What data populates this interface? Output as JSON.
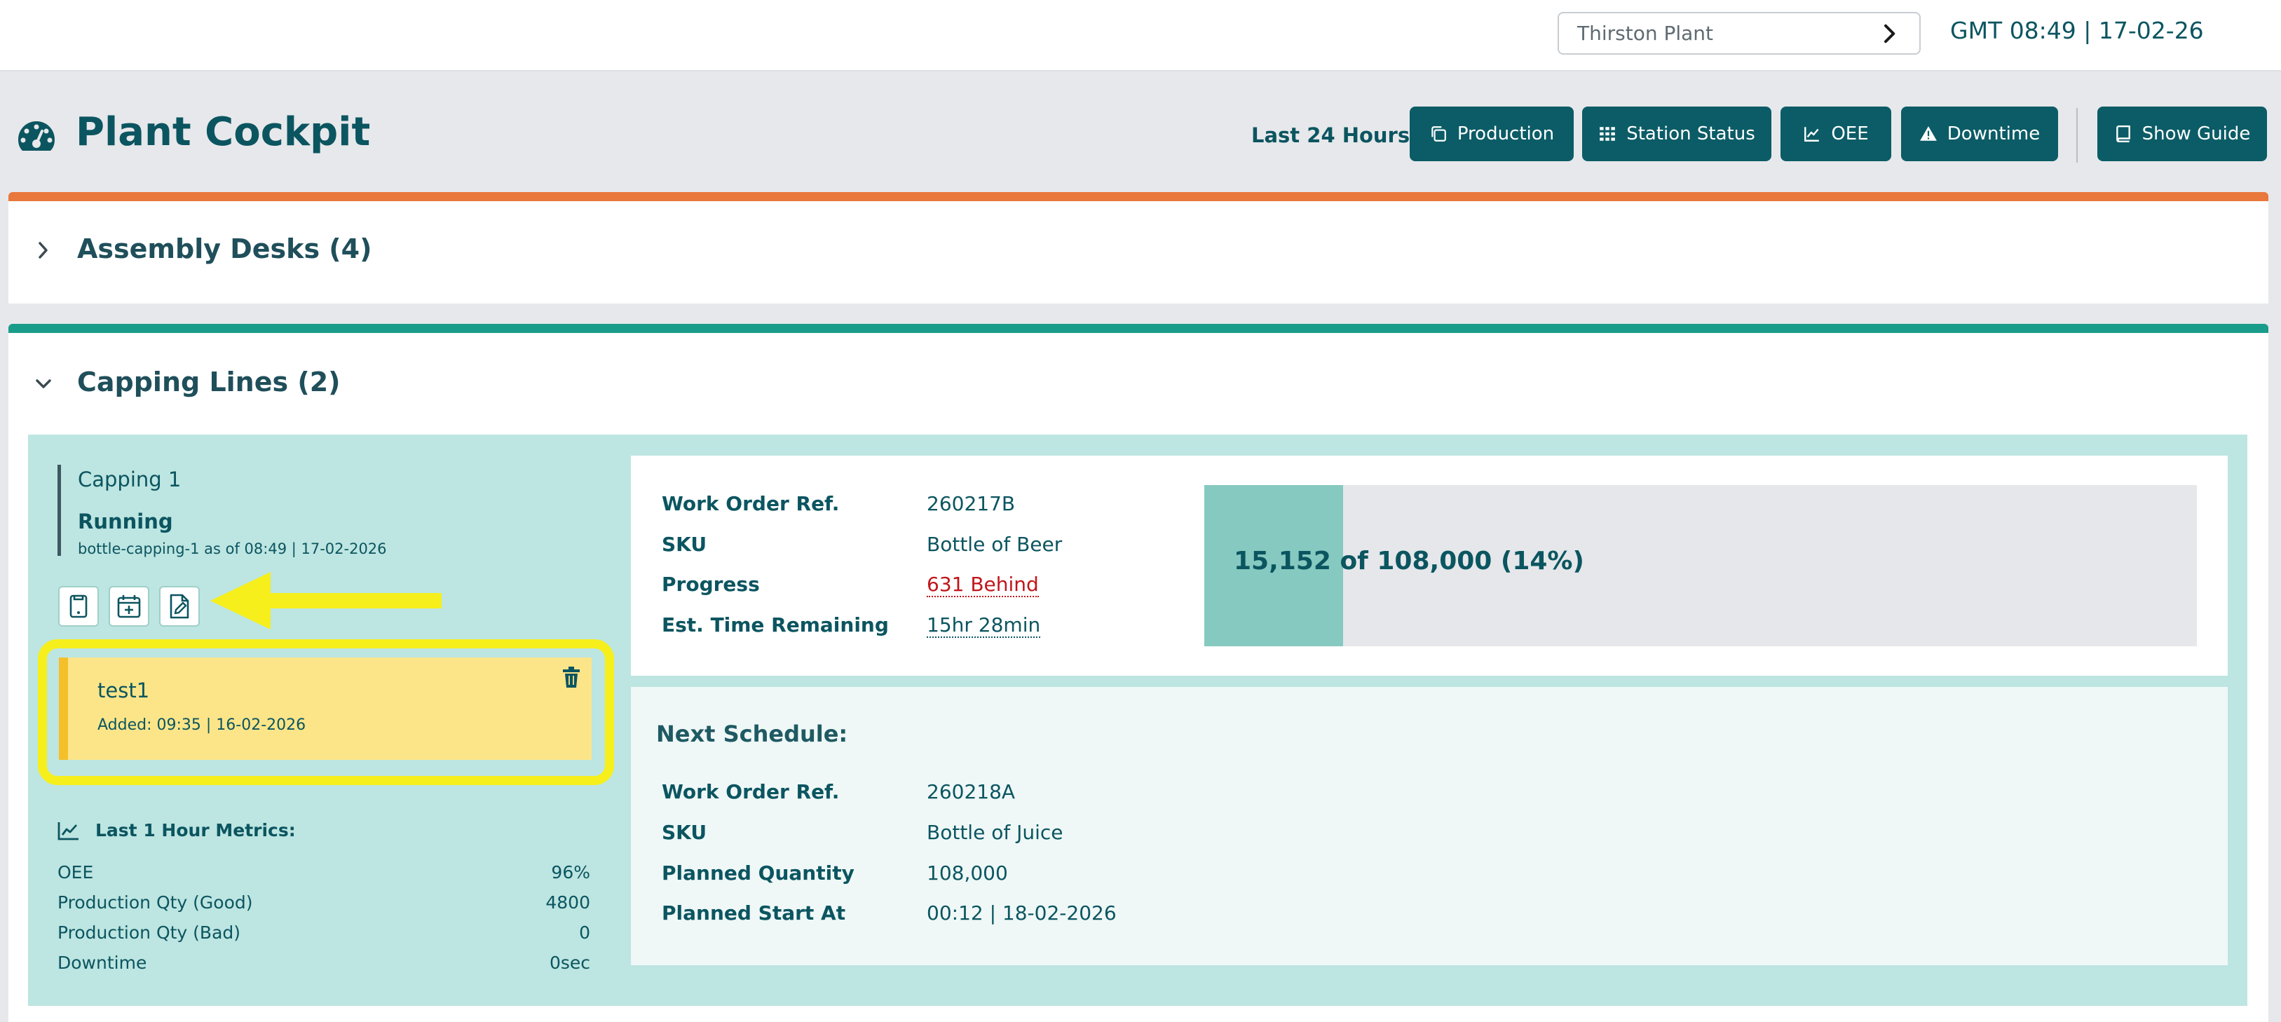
{
  "topbar": {
    "plant": "Thirston Plant",
    "clock": "GMT 08:49 | 17-02-26"
  },
  "header": {
    "title": "Plant Cockpit",
    "range_label": "Last 24 Hours:",
    "buttons": [
      {
        "label": "Production",
        "icon": "copy-icon"
      },
      {
        "label": "Station Status",
        "icon": "grid-icon"
      },
      {
        "label": "OEE",
        "icon": "line-chart-icon"
      },
      {
        "label": "Downtime",
        "icon": "warning-icon"
      }
    ],
    "guide_button": {
      "label": "Show Guide",
      "icon": "book-icon"
    }
  },
  "sections": {
    "assembly": {
      "title": "Assembly Desks (4)",
      "accent": "#e8783b",
      "expanded": false
    },
    "capping": {
      "title": "Capping Lines (2)",
      "accent": "#1a9c8a",
      "expanded": true
    }
  },
  "station": {
    "name": "Capping 1",
    "state": "Running",
    "sub": "bottle-capping-1 as of 08:49 | 17-02-2026",
    "tools": [
      "tablet-icon",
      "calendar-add-icon",
      "file-edit-icon"
    ],
    "note": {
      "title": "test1",
      "added": "Added: 09:35 | 16-02-2026"
    },
    "metrics": {
      "title": "Last 1 Hour Metrics:",
      "rows": [
        {
          "label": "OEE",
          "value": "96%"
        },
        {
          "label": "Production Qty (Good)",
          "value": "4800"
        },
        {
          "label": "Production Qty (Bad)",
          "value": "0"
        },
        {
          "label": "Downtime",
          "value": "0sec"
        }
      ]
    }
  },
  "work_order": {
    "rows": [
      {
        "key": "Work Order Ref.",
        "value": "260217B"
      },
      {
        "key": "SKU",
        "value": "Bottle of Beer"
      },
      {
        "key": "Progress",
        "value": "631 Behind"
      },
      {
        "key": "Est. Time Remaining",
        "value": "15hr 28min"
      }
    ],
    "progress": {
      "text": "15,152 of 108,000 (14%)",
      "fraction": 0.14
    }
  },
  "next_schedule": {
    "title": "Next Schedule:",
    "rows": [
      {
        "key": "Work Order Ref.",
        "value": "260218A"
      },
      {
        "key": "SKU",
        "value": "Bottle of Juice"
      },
      {
        "key": "Planned Quantity",
        "value": "108,000"
      },
      {
        "key": "Planned Start At",
        "value": "00:12 | 18-02-2026"
      }
    ]
  },
  "colors": {
    "primary": "#0b5c66",
    "highlight": "#f6ef1c",
    "note_bg": "#fce588",
    "behind": "#c0161b"
  }
}
